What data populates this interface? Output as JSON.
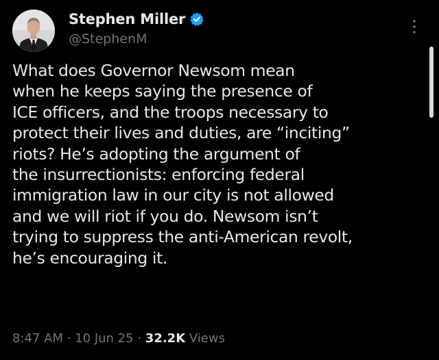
{
  "author": {
    "display_name": "Stephen Miller",
    "handle": "@StephenM",
    "verified_color": "#1d9bf0"
  },
  "tweet": {
    "lines": [
      "What does Governor Newsom mean",
      "when he keeps saying the presence of",
      "ICE officers, and the troops necessary to",
      "protect their lives and duties, are “inciting”",
      "riots? He’s adopting the argument of",
      "the insurrectionists: enforcing federal",
      "immigration law in our city is not allowed",
      "and we will riot if you do. Newsom isn’t",
      "trying to suppress the anti-American revolt,",
      "he’s encouraging it."
    ]
  },
  "meta": {
    "time": "8:47 AM",
    "separator": "·",
    "date": "10 Jun 25",
    "views_count": "32.2K",
    "views_label": "Views"
  },
  "icons": {
    "more": "more-vertical-icon",
    "verified": "verified-badge-icon"
  },
  "colors": {
    "background": "#000000",
    "text": "#e7e9ea",
    "secondary_text": "#71767b"
  }
}
